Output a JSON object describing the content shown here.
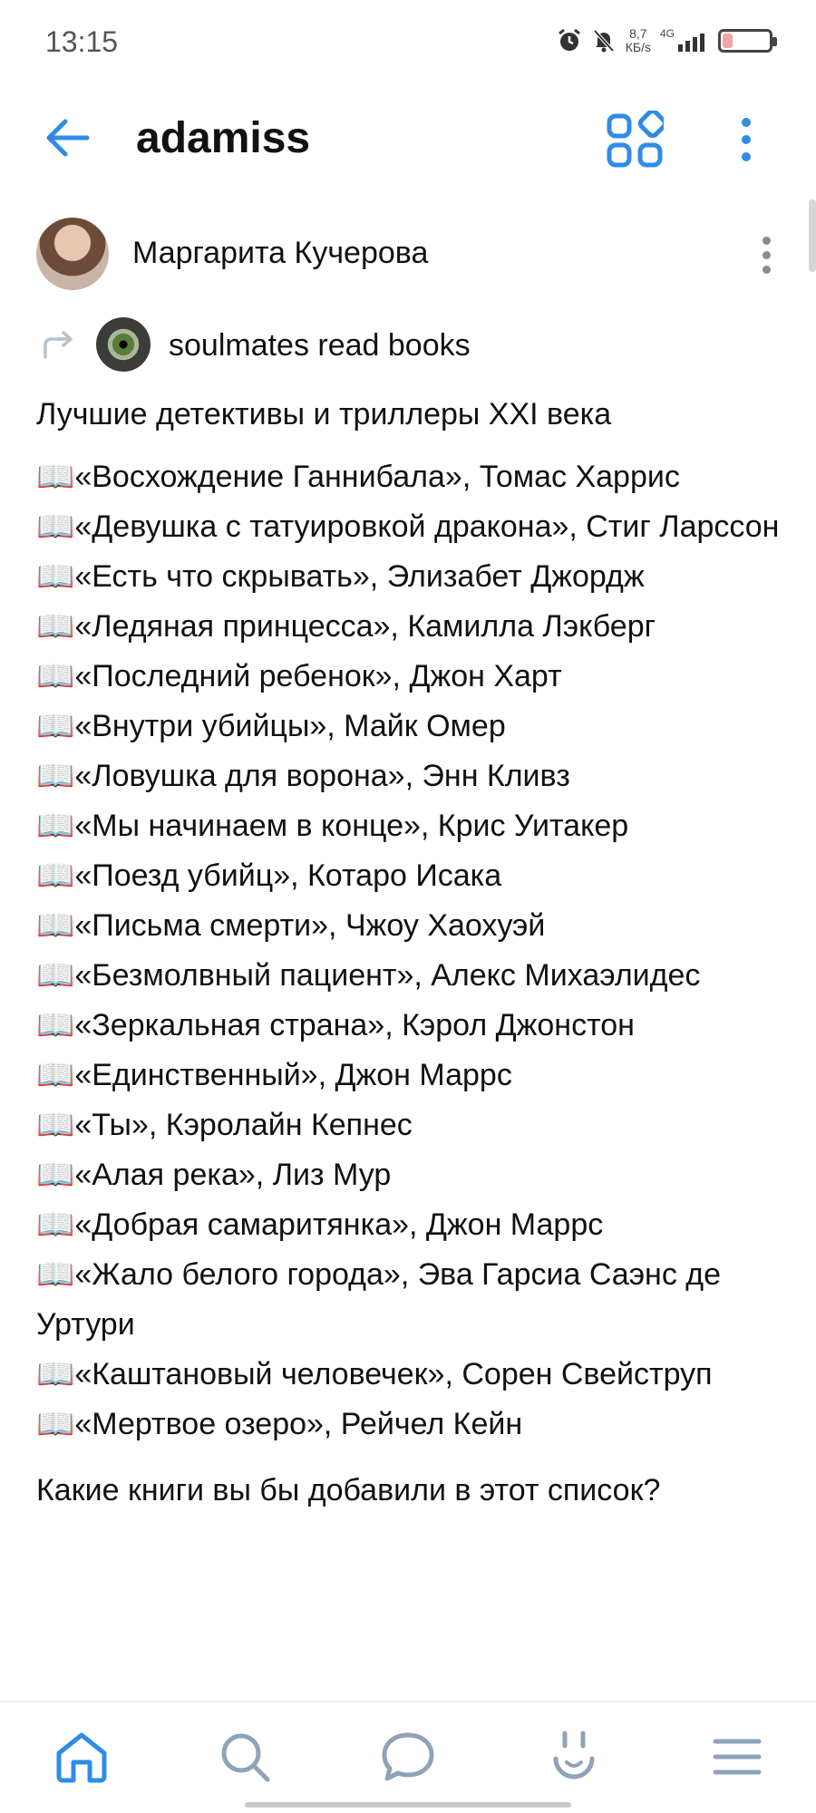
{
  "status_bar": {
    "time": "13:15",
    "speed_value": "8,7",
    "speed_unit": "КБ/s",
    "network": "4G",
    "battery_level": 0.22
  },
  "header": {
    "title": "adamiss",
    "icons": {
      "back": "back-arrow-icon",
      "apps": "apps-grid-icon",
      "more": "more-vertical-icon"
    }
  },
  "post": {
    "author": "Маргарита Кучерова",
    "repost_source": "soulmates read books",
    "heading": "Лучшие детективы и триллеры XXI века",
    "book_emoji": "📖",
    "books": [
      "«Восхождение Ганнибала», Томас Харрис",
      "«Девушка с татуировкой дракона», Стиг Ларссон",
      "«Есть что скрывать», Элизабет Джордж",
      "«Ледяная принцесса», Камилла Лэкберг",
      "«Последний ребенок», Джон Харт",
      "«Внутри убийцы», Майк Омер",
      "«Ловушка для ворона», Энн Кливз",
      "«Мы начинаем в конце», Крис Уитакер",
      "«Поезд убийц», Котаро Исака",
      "«Письма смерти», Чжоу Хаохуэй",
      "«Безмолвный пациент», Алекс Михаэлидес",
      "«Зеркальная страна», Кэрол Джонстон",
      "«Единственный», Джон Маррс",
      "«Ты», Кэролайн Кепнес",
      "«Алая река», Лиз Мур",
      "«Добрая самаритянка», Джон Маррс",
      "«Жало белого города», Эва Гарсиа Саэнс де Уртури",
      "«Каштановый человечек», Сорен Свейструп",
      "«Мертвое озеро», Рейчел Кейн"
    ],
    "question": "Какие книги вы бы добавили в этот список?"
  },
  "bottom_nav": {
    "items": [
      "home-icon",
      "search-icon",
      "messages-icon",
      "services-icon",
      "menu-icon"
    ],
    "active": "home-icon",
    "accent_color": "#2f8ce6",
    "inactive_color": "#8fa3b8"
  }
}
